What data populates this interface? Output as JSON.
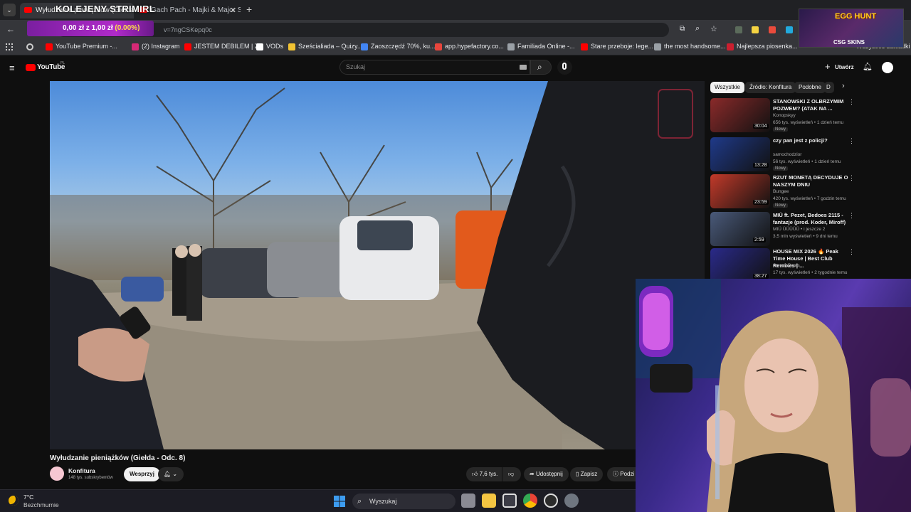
{
  "browser": {
    "tabs": [
      {
        "label": "Wyłudzanie pieniążków (Giełda - Odc. 8)",
        "active": true
      },
      {
        "label": "Gach Pach - Majki & Major SP2",
        "active": false
      }
    ],
    "new_tab_symbol": "+",
    "url_fragment": "v=7ngCSKepq0c",
    "bookmarks": [
      {
        "label": "YouTube Premium -...",
        "color": "#ff0000"
      },
      {
        "label": "(2) Instagram",
        "color": "#d62976"
      },
      {
        "label": "JESTEM DEBILEM | Z...",
        "color": "#ff0000"
      },
      {
        "label": "VODs",
        "color": "#ffffff"
      },
      {
        "label": "Sześcialiada – Quizy...",
        "color": "#f1c232"
      },
      {
        "label": "Zaoszczędź 70%, ku...",
        "color": "#4285f4"
      },
      {
        "label": "app.hypefactory.co...",
        "color": "#e8453c"
      },
      {
        "label": "Familiada Online -...",
        "color": "#9aa0a6"
      },
      {
        "label": "Stare przeboje: lege...",
        "color": "#ff0000"
      },
      {
        "label": "the most handsome...",
        "color": "#9aa0a6"
      },
      {
        "label": "Najlepsza piosenka...",
        "color": "#cc1f2f"
      }
    ],
    "all_bookmarks": "Wszystkie zakładki"
  },
  "stream_overlay": {
    "title": "KOLEJENY STRIMIRL",
    "money_text": "0,00 zł z 1,00 zł",
    "money_pct": "(0.00%)",
    "egg_hunt": "EGG HUNT",
    "sponsor": "CSG SKINS"
  },
  "youtube": {
    "logo": "YouTube",
    "logo_region": "PL",
    "search_placeholder": "Szukaj",
    "create_label": "Utwórz",
    "chips": [
      "Wszystkie",
      "Źródło: Konfitura",
      "Podobne",
      "D"
    ],
    "video_title": "Wyłudzanie pieniążków (Giełda - Odc. 8)",
    "channel": "Konfitura",
    "subscribers": "148 tys. subskrybentów",
    "support_label": "Wesprzyj",
    "likes": "7,6 tys.",
    "share_label": "Udostępnij",
    "save_label": "Zapisz",
    "more_label": "Podzi",
    "recommended": [
      {
        "title": "STANOWSKI Z OLBRZYMIM POZWEM? (ATAK NA ...",
        "channel": "Konopskyy",
        "meta": "656 tys. wyświetleń • 1 dzień temu",
        "badge": "Nowy",
        "duration": "30:04",
        "thumb": "#8a2a2a"
      },
      {
        "title": "czy pan jest z policji?",
        "channel": "samochodzior",
        "meta": "56 tys. wyświetleń • 1 dzień temu",
        "badge": "Nowy",
        "duration": "13:28",
        "thumb": "#1f3a8a"
      },
      {
        "title": "RZUT MONETĄ DECYDUJE O NASZYM DNIU",
        "channel": "Bungee",
        "meta": "420 tys. wyświetleń • 7 godzin temu",
        "badge": "Nowy",
        "duration": "23:59",
        "thumb": "#c23a2a"
      },
      {
        "title": "MIÜ ft. Pezet, Bedoes 2115 - fantazje (prod. Koder, Miroff)",
        "channel": "MIÜ ÜÜÜÜÜ • i jeszcze 2",
        "meta": "3,5 mln wyświetleń • 9 dni temu",
        "badge": "",
        "duration": "2:59",
        "thumb": "#4a5a7a"
      },
      {
        "title": "HOUSE MIX 2026 🔥 Peak Time House | Best Club Remixes | ...",
        "channel": "SonoraBeats",
        "meta": "17 tys. wyświetleń • 2 tygodnie temu",
        "badge": "",
        "duration": "38:27",
        "thumb": "#2a2a8a"
      }
    ]
  },
  "taskbar": {
    "temperature": "7°C",
    "weather": "Bezchmurnie",
    "search_placeholder": "Wyszukaj"
  }
}
